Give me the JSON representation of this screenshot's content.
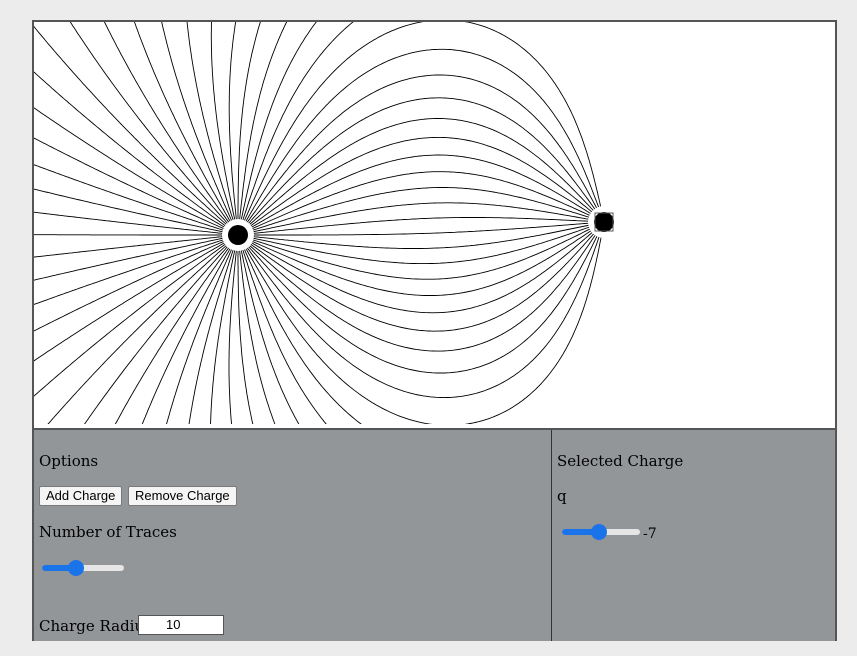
{
  "field_canvas": {
    "charges": [
      {
        "name": "positive-charge",
        "selected": false
      },
      {
        "name": "negative-charge",
        "selected": true
      }
    ]
  },
  "options": {
    "title": "Options",
    "add_charge_label": "Add Charge",
    "remove_charge_label": "Remove Charge",
    "traces_label": "Number of Traces",
    "traces_fraction": 0.42,
    "radius_label": "Charge Radius",
    "radius_value": "10"
  },
  "selected_charge": {
    "title": "Selected Charge",
    "q_label": "q",
    "q_fraction": 0.48,
    "q_value": "-7"
  },
  "colors": {
    "panel_bg": "#939699",
    "slider_accent": "#1a73e8",
    "field_line": "#000000"
  }
}
